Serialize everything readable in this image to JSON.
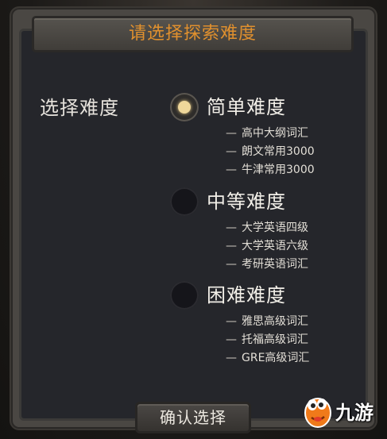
{
  "dialog": {
    "title": "请选择探索难度",
    "left_label": "选择难度",
    "confirm_label": "确认选择"
  },
  "options": [
    {
      "label": "简单难度",
      "selected": true,
      "subs": [
        "高中大纲词汇",
        "朗文常用3000",
        "牛津常用3000"
      ]
    },
    {
      "label": "中等难度",
      "selected": false,
      "subs": [
        "大学英语四级",
        "大学英语六级",
        "考研英语词汇"
      ]
    },
    {
      "label": "困难难度",
      "selected": false,
      "subs": [
        "雅思高级词汇",
        "托福高级词汇",
        "GRE高级词汇"
      ]
    }
  ],
  "sub_prefix": "—",
  "watermark": {
    "text": "九游",
    "icon": "mascot-logo-icon"
  },
  "colors": {
    "title": "#e0902e",
    "panel": "#25262b",
    "selected_dot": "#efd79a",
    "watermark_orange": "#f07a1a"
  }
}
